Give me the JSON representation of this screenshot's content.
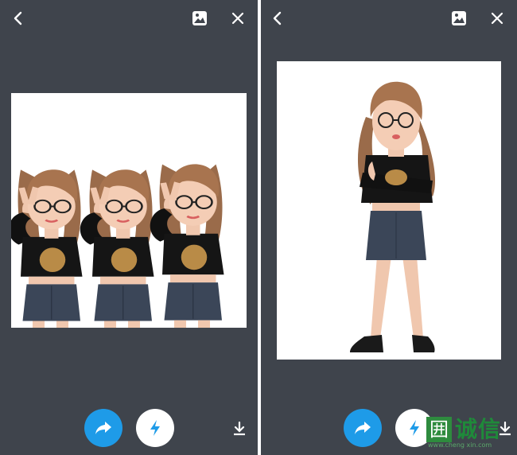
{
  "colors": {
    "panel_bg": "#3f444c",
    "share_button": "#1e9be8",
    "flash_button": "#ffffff",
    "icon": "#ffffff",
    "photo_bg": "#ffffff"
  },
  "panels": [
    {
      "toolbar": {
        "back_icon": "chevron-left-icon",
        "sticker_icon": "image-sticker-icon",
        "close_icon": "close-icon"
      },
      "image": {
        "subject": "three-avatars-peace-sign"
      },
      "actions": {
        "share_icon": "share-arrow-icon",
        "flash_icon": "lightning-icon",
        "download_icon": "download-icon"
      }
    },
    {
      "toolbar": {
        "back_icon": "chevron-left-icon",
        "sticker_icon": "image-sticker-icon",
        "close_icon": "close-icon"
      },
      "image": {
        "subject": "avatar-arms-crossed"
      },
      "actions": {
        "share_icon": "share-arrow-icon",
        "flash_icon": "lightning-icon",
        "download_icon": "download-icon"
      }
    }
  ],
  "watermark": {
    "brand": "诚信",
    "url": "www.cheng xin.com"
  }
}
